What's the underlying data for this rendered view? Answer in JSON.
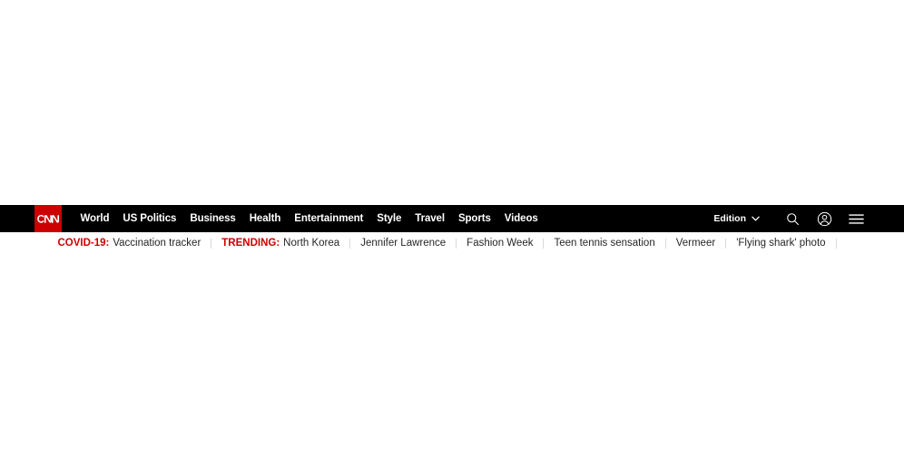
{
  "site": {
    "brand": "CNN",
    "brand_bg_color": "#cc0000",
    "navbar_bg_color": "#000000",
    "accent_red": "#cc0000",
    "body_text_color": "#262626"
  },
  "navbar": {
    "logo_label": "CNN",
    "links": [
      {
        "label": "World"
      },
      {
        "label": "US Politics"
      },
      {
        "label": "Business"
      },
      {
        "label": "Health"
      },
      {
        "label": "Entertainment"
      },
      {
        "label": "Style"
      },
      {
        "label": "Travel"
      },
      {
        "label": "Sports"
      },
      {
        "label": "Videos"
      }
    ],
    "edition": {
      "label": "Edition",
      "chevron_icon": "chevron-down-icon"
    },
    "actions": [
      {
        "icon": "search-icon",
        "name": "search-button"
      },
      {
        "icon": "user-account-icon",
        "name": "account-button"
      },
      {
        "icon": "hamburger-menu-icon",
        "name": "menu-button"
      }
    ]
  },
  "trending_bar": {
    "items": [
      {
        "label": "COVID-19:",
        "text": "Vaccination tracker"
      },
      {
        "label": "TRENDING:",
        "text": "North Korea"
      },
      {
        "label": "",
        "text": "Jennifer Lawrence"
      },
      {
        "label": "",
        "text": "Fashion Week"
      },
      {
        "label": "",
        "text": "Teen tennis sensation"
      },
      {
        "label": "",
        "text": "Vermeer"
      },
      {
        "label": "",
        "text": "'Flying shark' photo"
      }
    ],
    "trailing_separator": true
  }
}
